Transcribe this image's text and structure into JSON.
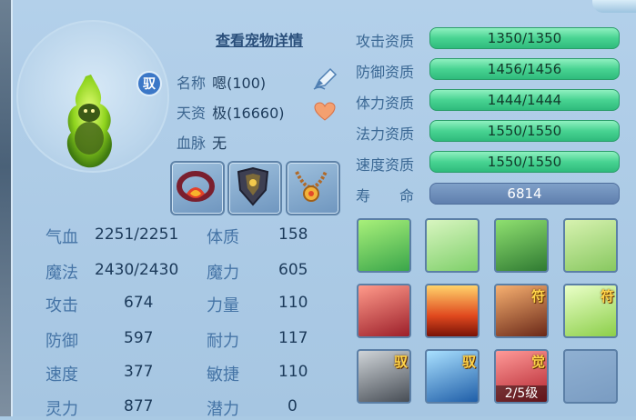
{
  "detail_link": "查看宠物详情",
  "badge": "驭",
  "info": {
    "name_label": "名称",
    "name_value": "嗯(100)",
    "aptitude_label": "天资",
    "aptitude_value": "极(16660)",
    "bloodline_label": "血脉",
    "bloodline_value": "无"
  },
  "stats_left": [
    {
      "label": "气血",
      "value": "2251/2251"
    },
    {
      "label": "魔法",
      "value": "2430/2430"
    },
    {
      "label": "攻击",
      "value": "674"
    },
    {
      "label": "防御",
      "value": "597"
    },
    {
      "label": "速度",
      "value": "377"
    },
    {
      "label": "灵力",
      "value": "877"
    }
  ],
  "stats_right": [
    {
      "label": "体质",
      "value": "158"
    },
    {
      "label": "魔力",
      "value": "605"
    },
    {
      "label": "力量",
      "value": "110"
    },
    {
      "label": "耐力",
      "value": "117"
    },
    {
      "label": "敏捷",
      "value": "110"
    },
    {
      "label": "潜力",
      "value": "0"
    }
  ],
  "aptitudes": [
    {
      "label": "攻击资质",
      "value": "1350/1350"
    },
    {
      "label": "防御资质",
      "value": "1456/1456"
    },
    {
      "label": "体力资质",
      "value": "1444/1444"
    },
    {
      "label": "法力资质",
      "value": "1550/1550"
    },
    {
      "label": "速度资质",
      "value": "1550/1550"
    }
  ],
  "lifespan": {
    "label": "寿　　命",
    "value": "6814"
  },
  "skills": [
    {
      "name": "figure-skill-icon",
      "tag": "",
      "lvl": ""
    },
    {
      "name": "hand-skill-icon",
      "tag": "",
      "lvl": ""
    },
    {
      "name": "cat-skill-icon",
      "tag": "",
      "lvl": ""
    },
    {
      "name": "boot-skill-icon",
      "tag": "",
      "lvl": ""
    },
    {
      "name": "card-skill-icon",
      "tag": "",
      "lvl": ""
    },
    {
      "name": "fire-skill-icon",
      "tag": "",
      "lvl": ""
    },
    {
      "name": "shadow-skill-icon",
      "tag": "符",
      "lvl": ""
    },
    {
      "name": "palm-skill-icon",
      "tag": "符",
      "lvl": ""
    },
    {
      "name": "orbs-skill-icon",
      "tag": "驭",
      "lvl": ""
    },
    {
      "name": "ice-skill-icon",
      "tag": "驭",
      "lvl": ""
    },
    {
      "name": "awaken-skill-icon",
      "tag": "觉",
      "lvl": "2/5级"
    },
    {
      "name": "empty-skill-slot",
      "tag": "",
      "lvl": ""
    }
  ],
  "colors": {
    "accent_green": "#48d392",
    "label_blue": "#4574a6",
    "tag_gold": "#ffd54a"
  }
}
